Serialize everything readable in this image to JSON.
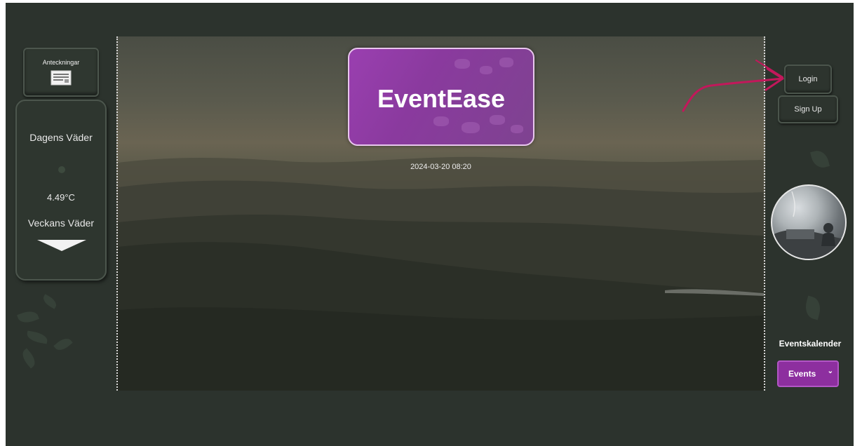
{
  "notes": {
    "label": "Anteckningar",
    "icon": "notepad-icon"
  },
  "weather": {
    "title": "Dagens Väder",
    "icon": "weather-icon",
    "temperature": "4.49°C",
    "weekly_label": "Veckans Väder",
    "expand_icon": "triangle-down-icon"
  },
  "hero": {
    "logo": "EventEase",
    "datetime": "2024-03-20 08:20"
  },
  "auth": {
    "login": "Login",
    "signup": "Sign Up"
  },
  "calendar": {
    "label": "Eventskalender",
    "dropdown_label": "Events",
    "dropdown_icon": "chevron-down-icon"
  },
  "colors": {
    "background": "#2c332d",
    "accent_purple": "#8d2f9f",
    "annotation_arrow": "#c2185b"
  }
}
